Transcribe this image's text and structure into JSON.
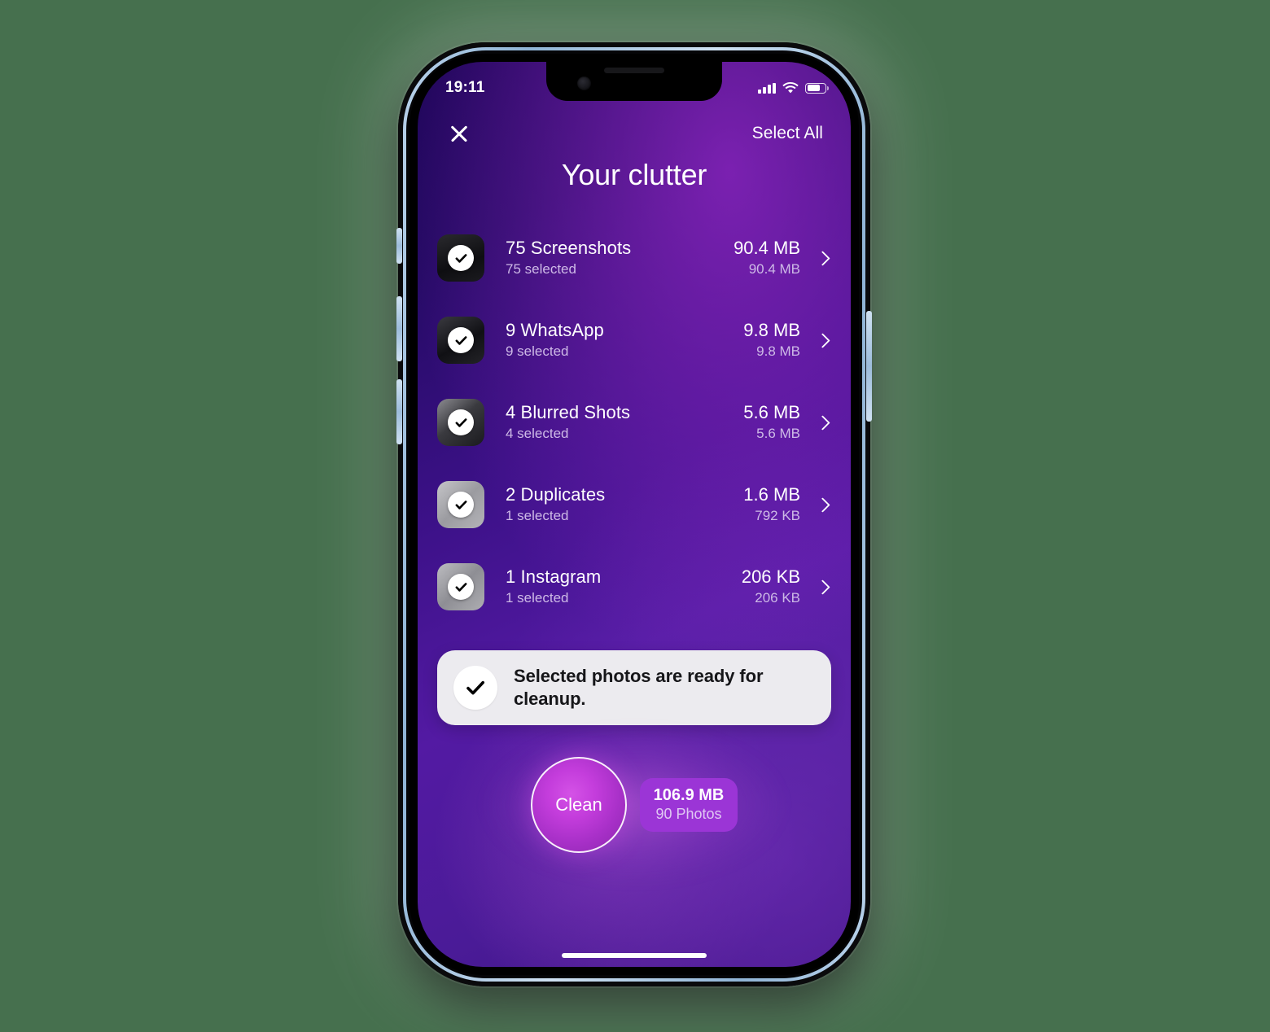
{
  "status_bar": {
    "time": "19:11",
    "signal_icon": "signal-bars-icon",
    "wifi_icon": "wifi-icon",
    "battery_icon": "battery-icon",
    "battery_level_pct": 75
  },
  "nav": {
    "close_icon": "close-icon",
    "select_all_label": "Select All"
  },
  "header": {
    "title": "Your clutter"
  },
  "colors": {
    "accent_purple": "#9b35d6",
    "clean_button": "#c43ddc",
    "background_dark": "#1d0558",
    "background_light": "#531aa3",
    "banner_bg": "#ecebef",
    "page_bg": "#46704E"
  },
  "clutter_list": [
    {
      "title": "75 Screenshots",
      "subtitle": "75 selected",
      "size": "90.4 MB",
      "size_selected": "90.4 MB",
      "checked": true,
      "thumb_tone": "dark"
    },
    {
      "title": "9 WhatsApp",
      "subtitle": "9 selected",
      "size": "9.8 MB",
      "size_selected": "9.8 MB",
      "checked": true,
      "thumb_tone": "dark"
    },
    {
      "title": "4 Blurred Shots",
      "subtitle": "4 selected",
      "size": "5.6 MB",
      "size_selected": "5.6 MB",
      "checked": true,
      "thumb_tone": "mid"
    },
    {
      "title": "2 Duplicates",
      "subtitle": "1 selected",
      "size": "1.6 MB",
      "size_selected": "792 KB",
      "checked": true,
      "thumb_tone": "light"
    },
    {
      "title": "1 Instagram",
      "subtitle": "1 selected",
      "size": "206 KB",
      "size_selected": "206 KB",
      "checked": true,
      "thumb_tone": "light"
    }
  ],
  "banner": {
    "icon": "check-icon",
    "text": "Selected photos are ready for cleanup."
  },
  "clean_action": {
    "button_label": "Clean",
    "badge_size": "106.9 MB",
    "badge_count": "90 Photos"
  }
}
